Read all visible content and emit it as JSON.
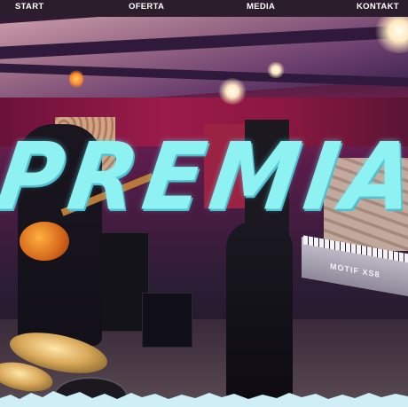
{
  "nav": {
    "items": [
      {
        "label": "START"
      },
      {
        "label": "OFERTA"
      },
      {
        "label": "MEDIA"
      },
      {
        "label": "KONTAKT"
      }
    ],
    "background": "#2c1d2c",
    "text_color": "#ffffff"
  },
  "hero": {
    "brand_text": "PREMIA",
    "brand_color": "#8ef2f2",
    "keyboard_label": "MOTIF XS8",
    "torn_edge_color": "#cdeff5"
  }
}
